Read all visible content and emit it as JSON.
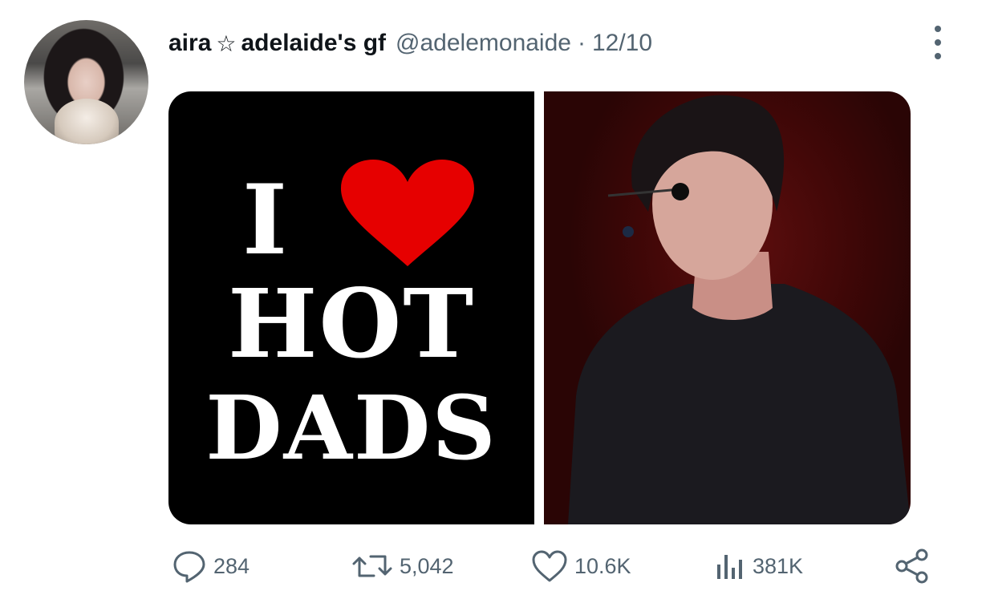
{
  "tweet": {
    "display_name": "aira",
    "star": "☆",
    "display_name_suffix": "adelaide's gf",
    "handle": "@adelemonaide",
    "separator": "·",
    "date": "12/10"
  },
  "media": {
    "shirt": {
      "line1": "I",
      "line2": "HOT",
      "line3": "DADS",
      "heart_color": "#e60000"
    }
  },
  "actions": {
    "replies": "284",
    "retweets": "5,042",
    "likes": "10.6K",
    "views": "381K"
  },
  "icons": [
    "more-icon",
    "reply-icon",
    "retweet-icon",
    "like-icon",
    "views-icon",
    "share-icon"
  ],
  "colors": {
    "text": "#0f1419",
    "muted": "#536471"
  }
}
